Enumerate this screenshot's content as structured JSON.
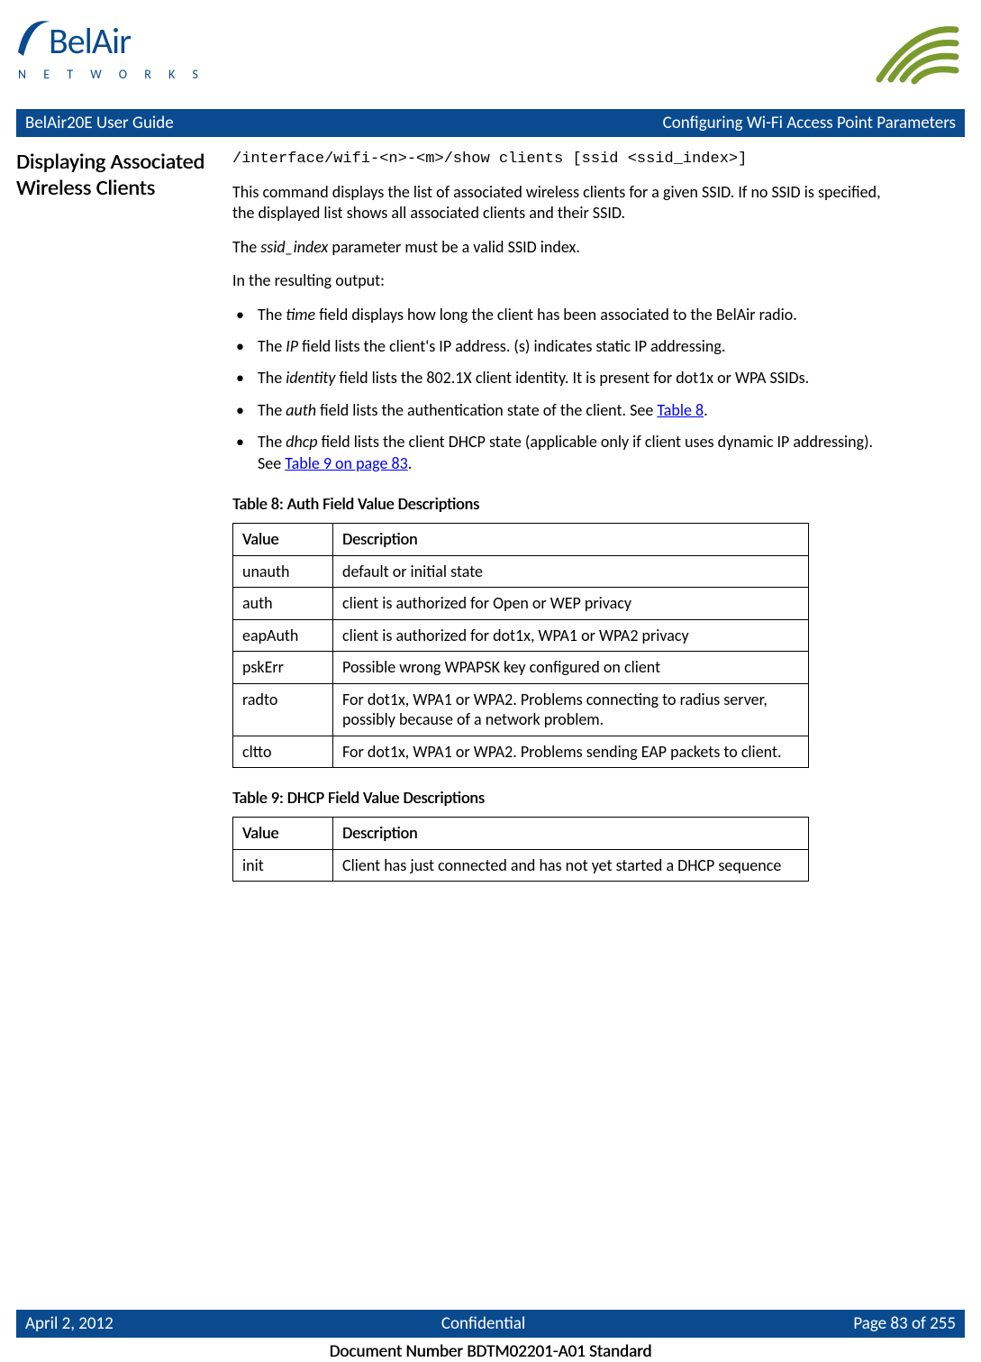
{
  "header": {
    "logo_main": "BelAir",
    "logo_sub": "N E T W O R K S",
    "bar_left": "BelAir20E User Guide",
    "bar_right": "Configuring Wi-Fi Access Point Parameters"
  },
  "section": {
    "heading": "Displaying Associated Wireless Clients",
    "command_prefix": "/interface/wifi-<n>-<m>/",
    "command_rest": "show clients [ssid ",
    "command_arg": "<ssid_index>",
    "command_close": "]",
    "para1": "This command displays the list of associated wireless clients for a given SSID. If no SSID is specified, the displayed list shows all associated clients and their SSID.",
    "para2_pre": "The ",
    "para2_ital": "ssid_index",
    "para2_post": " parameter must be a valid SSID index.",
    "para3": "In the resulting output:",
    "bullets": [
      {
        "pre": "The ",
        "ital": "time",
        "post": " field displays how long the client has been associated to the BelAir radio."
      },
      {
        "pre": "The ",
        "ital": "IP",
        "post": " field lists the client's IP address. (s) indicates static IP addressing."
      },
      {
        "pre": "The ",
        "ital": "identity",
        "post": " field lists the 802.1X client identity. It is present for dot1x or WPA SSIDs."
      },
      {
        "pre": "The ",
        "ital": "auth",
        "post": " field lists the authentication state of the client. See ",
        "link": "Table 8",
        "tail": "."
      },
      {
        "pre": "The ",
        "ital": "dhcp",
        "post": " field lists the client DHCP state (applicable only if client uses dynamic IP addressing). See ",
        "link": "Table 9 on page 83",
        "tail": "."
      }
    ]
  },
  "table8": {
    "caption": "Table 8: Auth Field Value Descriptions",
    "head_value": "Value",
    "head_desc": "Description",
    "rows": [
      {
        "v": "unauth",
        "d": "default or initial state"
      },
      {
        "v": "auth",
        "d": "client is authorized for Open or WEP privacy"
      },
      {
        "v": "eapAuth",
        "d": "client is authorized for dot1x, WPA1 or WPA2 privacy"
      },
      {
        "v": "pskErr",
        "d": "Possible wrong WPAPSK key configured on client"
      },
      {
        "v": "radto",
        "d": "For dot1x, WPA1 or WPA2. Problems connecting to radius server, possibly because of a network problem."
      },
      {
        "v": "cltto",
        "d": "For dot1x, WPA1 or WPA2. Problems sending EAP packets to client."
      }
    ]
  },
  "table9": {
    "caption": "Table 9: DHCP Field Value Descriptions",
    "head_value": "Value",
    "head_desc": "Description",
    "rows": [
      {
        "v": "init",
        "d": "Client has just connected and has not yet started a DHCP sequence"
      }
    ]
  },
  "footer": {
    "date": "April 2, 2012",
    "center": "Confidential",
    "page": "Page 83 of 255",
    "docnum": "Document Number BDTM02201-A01 Standard"
  }
}
